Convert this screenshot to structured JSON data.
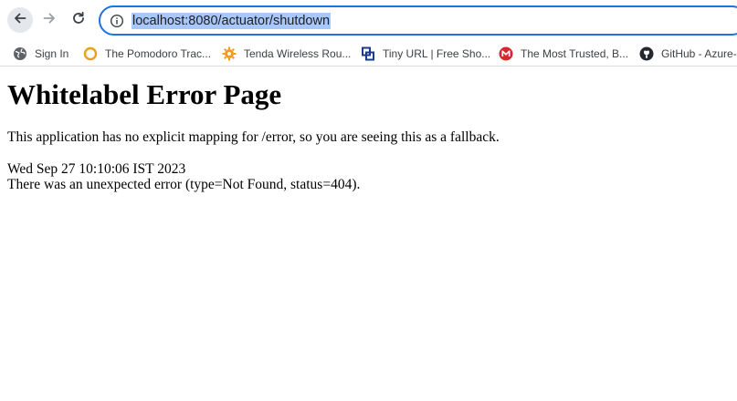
{
  "browser": {
    "address_bar": {
      "url": "localhost:8080/actuator/shutdown"
    },
    "bookmarks": [
      {
        "label": "Sign In",
        "icon": "globe-icon"
      },
      {
        "label": "The Pomodoro Trac...",
        "icon": "pomodoro-icon"
      },
      {
        "label": "Tenda Wireless Rou...",
        "icon": "tenda-icon"
      },
      {
        "label": "Tiny URL | Free Sho...",
        "icon": "tinyurl-icon"
      },
      {
        "label": "The Most Trusted, B...",
        "icon": "mega-icon"
      },
      {
        "label": "GitHub - Azure-",
        "icon": "github-icon"
      }
    ]
  },
  "page": {
    "title": "Whitelabel Error Page",
    "message": "This application has no explicit mapping for /error, so you are seeing this as a fallback.",
    "timestamp": "Wed Sep 27 10:10:06 IST 2023",
    "error": "There was an unexpected error (type=Not Found, status=404)."
  },
  "colors": {
    "omnibox_border": "#1a73e8",
    "url_selection": "#a8c7fa",
    "back_button_bg": "#e4e7eb"
  }
}
